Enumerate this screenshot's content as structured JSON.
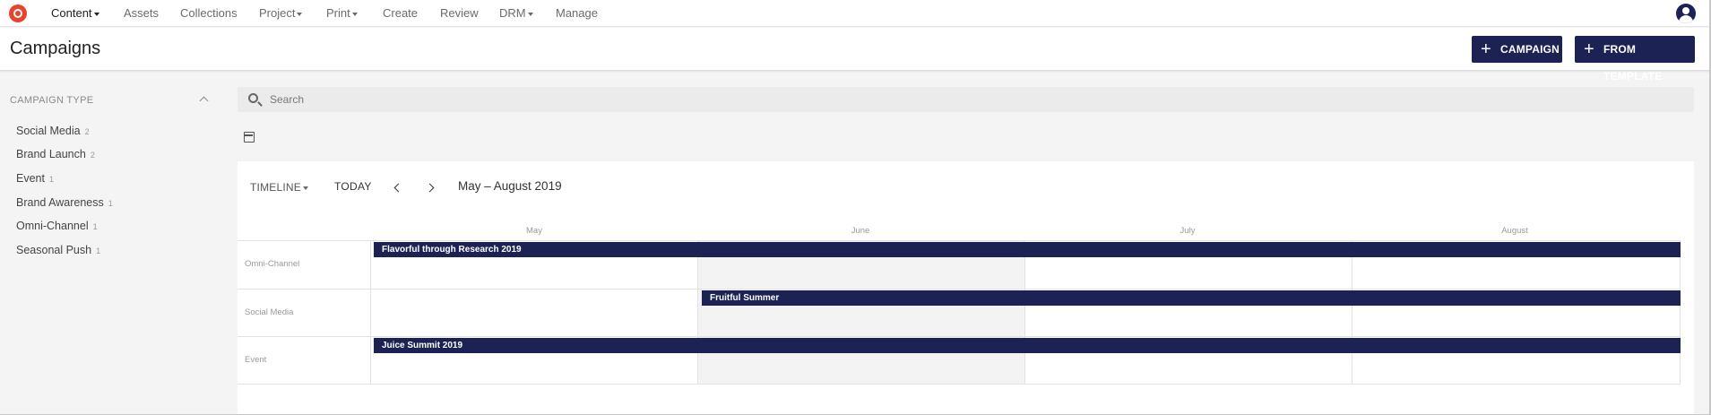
{
  "nav": {
    "items": [
      {
        "label": "Content",
        "dropdown": true,
        "active": true
      },
      {
        "label": "Assets",
        "dropdown": false,
        "active": false
      },
      {
        "label": "Collections",
        "dropdown": false,
        "active": false
      },
      {
        "label": "Project",
        "dropdown": true,
        "active": false
      },
      {
        "label": "Print",
        "dropdown": true,
        "active": false
      },
      {
        "label": "Create",
        "dropdown": false,
        "active": false
      },
      {
        "label": "Review",
        "dropdown": false,
        "active": false
      },
      {
        "label": "DRM",
        "dropdown": true,
        "active": false
      },
      {
        "label": "Manage",
        "dropdown": false,
        "active": false
      }
    ]
  },
  "header": {
    "title": "Campaigns",
    "add_campaign_label": "CAMPAIGN",
    "from_template_label": "FROM TEMPLATE"
  },
  "sidebar": {
    "heading": "CAMPAIGN TYPE",
    "items": [
      {
        "label": "Social Media",
        "count": "2"
      },
      {
        "label": "Brand Launch",
        "count": "2"
      },
      {
        "label": "Event",
        "count": "1"
      },
      {
        "label": "Brand Awareness",
        "count": "1"
      },
      {
        "label": "Omni-Channel",
        "count": "1"
      },
      {
        "label": "Seasonal Push",
        "count": "1"
      }
    ]
  },
  "search": {
    "placeholder": "Search",
    "value": ""
  },
  "timeline": {
    "view_label": "TIMELINE",
    "today_label": "TODAY",
    "range_label": "May – August 2019",
    "months": [
      "May",
      "June",
      "July",
      "August"
    ],
    "rows": [
      {
        "label": "Omni-Channel",
        "campaign": "Flavorful through Research 2019"
      },
      {
        "label": "Social Media",
        "campaign": "Fruitful Summer"
      },
      {
        "label": "Event",
        "campaign": "Juice Summit 2019"
      }
    ]
  },
  "colors": {
    "accent": "#1c2354",
    "logo": "#e8432e"
  }
}
